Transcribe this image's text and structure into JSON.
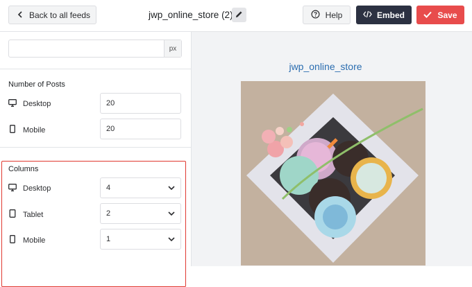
{
  "header": {
    "back_label": "Back to all feeds",
    "feed_title": "jwp_online_store (2)",
    "help_label": "Help",
    "embed_label": "Embed",
    "save_label": "Save"
  },
  "sidebar": {
    "width_unit": "px",
    "posts": {
      "heading": "Number of Posts",
      "desktop_label": "Desktop",
      "desktop_value": "20",
      "mobile_label": "Mobile",
      "mobile_value": "20"
    },
    "columns": {
      "heading": "Columns",
      "desktop_label": "Desktop",
      "desktop_value": "4",
      "tablet_label": "Tablet",
      "tablet_value": "2",
      "mobile_label": "Mobile",
      "mobile_value": "1"
    }
  },
  "preview": {
    "account_name": "jwp_online_store"
  },
  "colors": {
    "embed": "#2c3142",
    "save": "#e84c4c",
    "highlight": "#e0382f",
    "link": "#2b6db0"
  },
  "icons": [
    "chevron-left-icon",
    "pencil-icon",
    "help-circle-icon",
    "code-icon",
    "check-icon",
    "desktop-icon",
    "mobile-icon",
    "tablet-icon",
    "chevron-down-icon"
  ]
}
